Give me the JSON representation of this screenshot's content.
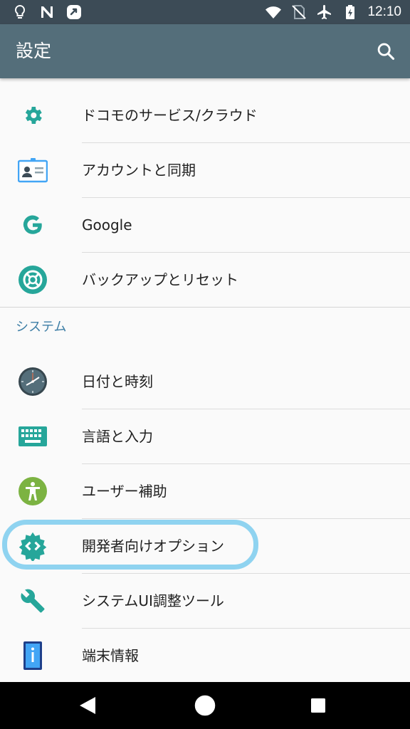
{
  "status_bar": {
    "time": "12:10",
    "left_icons": [
      "bulb-icon",
      "n-icon",
      "sync-icon"
    ],
    "right_icons": [
      "wifi-icon",
      "no-sim-icon",
      "airplane-icon",
      "battery-icon"
    ]
  },
  "app_bar": {
    "title": "設定",
    "search_icon": "search-icon"
  },
  "items_top": [
    {
      "label": "ドコモのサービス/クラウド",
      "icon": "gear-icon"
    },
    {
      "label": "アカウントと同期",
      "icon": "account-card-icon"
    },
    {
      "label": "Google",
      "icon": "google-icon"
    },
    {
      "label": "バックアップとリセット",
      "icon": "backup-icon"
    }
  ],
  "section": {
    "title": "システム"
  },
  "items_system": [
    {
      "label": "日付と時刻",
      "icon": "clock-icon"
    },
    {
      "label": "言語と入力",
      "icon": "keyboard-icon"
    },
    {
      "label": "ユーザー補助",
      "icon": "accessibility-icon"
    },
    {
      "label": "開発者向けオプション",
      "icon": "developer-options-icon",
      "highlighted": true
    },
    {
      "label": "システムUI調整ツール",
      "icon": "wrench-icon"
    },
    {
      "label": "端末情報",
      "icon": "phone-info-icon"
    }
  ],
  "colors": {
    "status_bar": "#3c4b56",
    "app_bar": "#546e7a",
    "accent_teal": "#26a69a",
    "section_header": "#3f7fa6",
    "highlight_stroke": "#8fd3f0"
  },
  "nav_bar": {
    "buttons": [
      "back-icon",
      "home-icon",
      "recents-icon"
    ]
  }
}
